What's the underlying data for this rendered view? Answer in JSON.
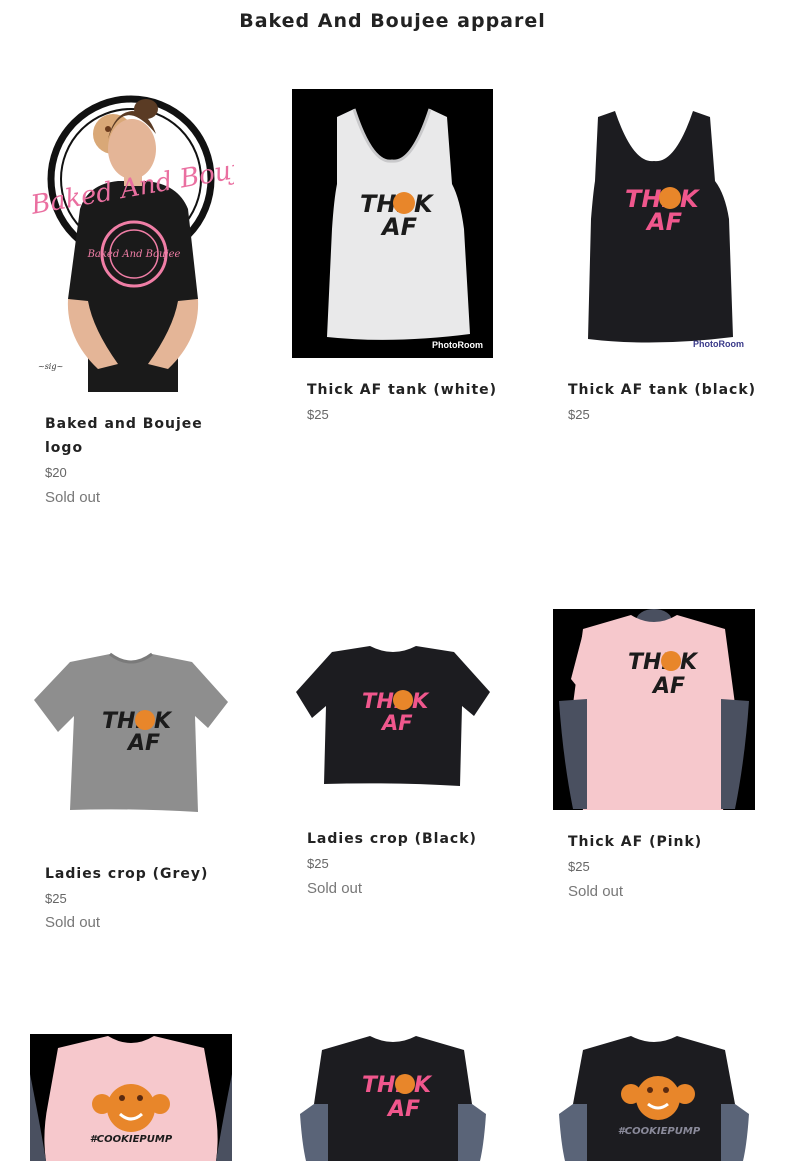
{
  "collection": {
    "title": "Baked And Boujee apparel"
  },
  "products": [
    {
      "title": "Baked and Boujee logo",
      "price": "$20",
      "status": "Sold out",
      "image": "man-black-logo-tee"
    },
    {
      "title": "Thick AF tank (white)",
      "price": "$25",
      "status": "",
      "image": "white-tank-photo"
    },
    {
      "title": "Thick AF tank (black)",
      "price": "$25",
      "status": "",
      "image": "black-tank-photo"
    },
    {
      "title": "Ladies crop (Grey)",
      "price": "$25",
      "status": "Sold out",
      "image": "grey-crop-tee"
    },
    {
      "title": "Ladies crop (Black)",
      "price": "$25",
      "status": "Sold out",
      "image": "black-crop-tee"
    },
    {
      "title": "Thick AF (Pink)",
      "price": "$25",
      "status": "Sold out",
      "image": "pink-tee-mannequin"
    },
    {
      "title": "",
      "price": "",
      "status": "",
      "image": "pink-cookiepump-tee"
    },
    {
      "title": "",
      "price": "",
      "status": "",
      "image": "black-thick-af-tee"
    },
    {
      "title": "",
      "price": "",
      "status": "",
      "image": "black-cookiepump-tee"
    }
  ],
  "image_text": {
    "thick": "THI",
    "thick_k": "K",
    "af": "AF",
    "brand_script": "Baked And Boujee",
    "watermark": "PhotoRoom",
    "cookiepump": "#COOKIEPUMP"
  },
  "colors": {
    "pink_print": "#f0578d",
    "black_print": "#1b1b1b",
    "cookie": "#e8862a",
    "pink_shirt": "#f6c8cc",
    "grey_shirt": "#8e8e8e",
    "black_shirt": "#1c1c20"
  }
}
